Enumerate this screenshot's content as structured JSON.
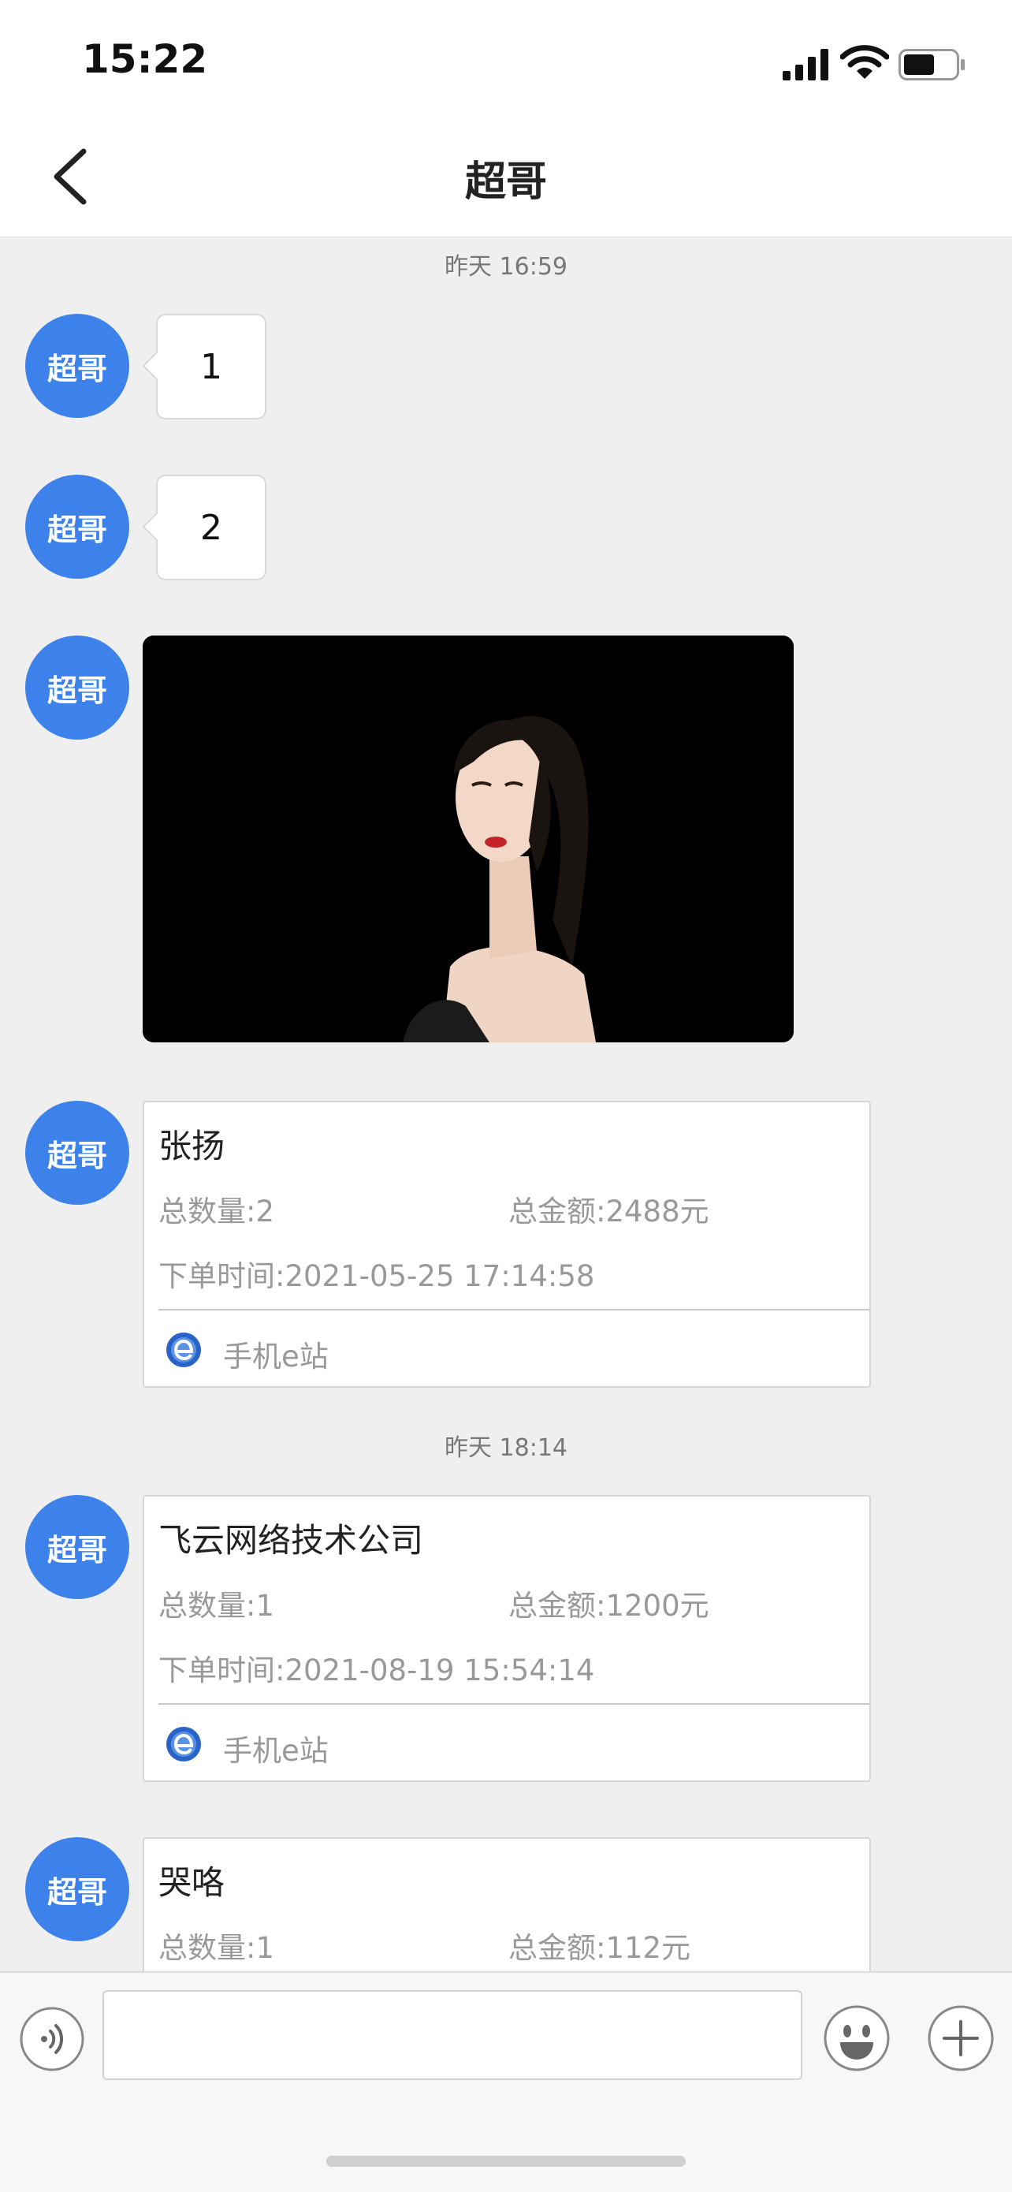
{
  "status_bar": {
    "time": "15:22"
  },
  "header": {
    "title": "超哥"
  },
  "timestamps": [
    "昨天 16:59",
    "昨天 18:14"
  ],
  "sender": {
    "avatar_text": "超哥",
    "avatar_color": "#3c82ea"
  },
  "messages": [
    {
      "type": "text",
      "text": "1"
    },
    {
      "type": "text",
      "text": "2"
    },
    {
      "type": "image",
      "icon": "portrait-photo"
    }
  ],
  "orders": [
    {
      "name": "张扬",
      "quantity": "总数量:2",
      "amount": "总金额:2488元",
      "order_time": "下单时间:2021-05-25 17:14:58",
      "source": "手机e站"
    },
    {
      "name": "飞云网络技术公司",
      "quantity": "总数量:1",
      "amount": "总金额:1200元",
      "order_time": "下单时间:2021-08-19 15:54:14",
      "source": "手机e站"
    },
    {
      "name": "哭咯",
      "quantity": "总数量:1",
      "amount": "总金额:112元"
    }
  ],
  "input_bar": {
    "input_value": ""
  },
  "icons": [
    "back-icon",
    "voice-icon",
    "emoji-icon",
    "plus-icon",
    "ie-logo-icon",
    "signal-icon",
    "wifi-icon",
    "battery-icon"
  ]
}
